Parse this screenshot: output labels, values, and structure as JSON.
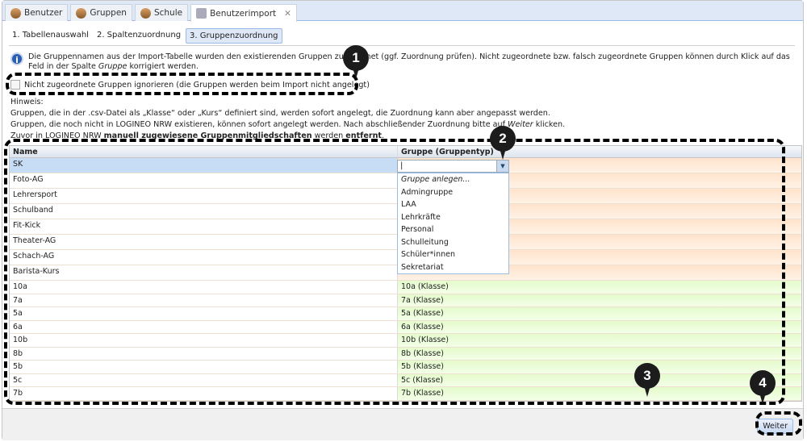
{
  "tabs": [
    {
      "label": "Benutzer",
      "icon": "user-icon"
    },
    {
      "label": "Gruppen",
      "icon": "group-icon"
    },
    {
      "label": "Schule",
      "icon": "school-icon"
    },
    {
      "label": "Benutzerimport",
      "icon": "import-icon",
      "active": true
    }
  ],
  "steps": [
    "1. Tabellenauswahl",
    "2. Spaltenzuordnung",
    "3. Gruppenzuordnung"
  ],
  "info": {
    "pre": "Die Gruppennamen aus der Import-Tabelle wurden den existierenden Gruppen zugeordnet (ggf. Zuordnung prüfen). Nicht zugeordnete bzw. falsch zugeordnete Gruppen können durch Klick auf das Feld in der Spalte ",
    "em": "Gruppe",
    "post": " korrigiert werden."
  },
  "checkbox": {
    "label": "Nicht zugeordnete Gruppen ignorieren (die Gruppen werden beim Import nicht angelegt)",
    "checked": false
  },
  "hint": {
    "title": "Hinweis:",
    "line1": "Gruppen, die in der .csv-Datei als „Klasse“ oder „Kurs“ definiert sind, werden sofort angelegt, die Zuordnung kann aber angepasst werden.",
    "line2_pre": "Gruppen, die noch nicht in LOGINEO NRW existieren, können sofort angelegt werden. Nach abschließender Zuordnung bitte auf ",
    "line2_em": "Weiter",
    "line2_post": " klicken.",
    "line3_pre": "Zuvor in LOGINEO NRW ",
    "line3_b1": "manuell zugewiesene Gruppenmitgliedschaften",
    "line3_mid": " werden ",
    "line3_b2": "entfernt",
    "line3_post": "."
  },
  "grid": {
    "headers": [
      "Name",
      "Gruppe (Gruppentyp)"
    ],
    "rows": [
      {
        "name": "SK",
        "group": "",
        "status": "unassigned"
      },
      {
        "name": "Foto-AG",
        "group": "",
        "status": "unassigned"
      },
      {
        "name": "Lehrersport",
        "group": "",
        "status": "unassigned"
      },
      {
        "name": "Schulband",
        "group": "",
        "status": "unassigned"
      },
      {
        "name": "Fit-Kick",
        "group": "",
        "status": "unassigned"
      },
      {
        "name": "Theater-AG",
        "group": "",
        "status": "unassigned"
      },
      {
        "name": "Schach-AG",
        "group": "",
        "status": "unassigned"
      },
      {
        "name": "Barista-Kurs",
        "group": "",
        "status": "unassigned"
      },
      {
        "name": "10a",
        "group": "10a (Klasse)",
        "status": "assigned"
      },
      {
        "name": "7a",
        "group": "7a (Klasse)",
        "status": "assigned"
      },
      {
        "name": "5a",
        "group": "5a (Klasse)",
        "status": "assigned"
      },
      {
        "name": "6a",
        "group": "6a (Klasse)",
        "status": "assigned"
      },
      {
        "name": "10b",
        "group": "10b (Klasse)",
        "status": "assigned"
      },
      {
        "name": "8b",
        "group": "8b (Klasse)",
        "status": "assigned"
      },
      {
        "name": "5b",
        "group": "5b (Klasse)",
        "status": "assigned"
      },
      {
        "name": "5c",
        "group": "5c (Klasse)",
        "status": "assigned"
      },
      {
        "name": "7b",
        "group": "7b (Klasse)",
        "status": "assigned"
      }
    ]
  },
  "dropdown": {
    "value": "",
    "options": [
      "Gruppe anlegen...",
      "Admingruppe",
      "LAA",
      "Lehrkräfte",
      "Personal",
      "Schulleitung",
      "Schüler*innen",
      "Sekretariat"
    ]
  },
  "footer": {
    "next_label": "Weiter"
  },
  "markers": [
    "1",
    "2",
    "3",
    "4"
  ]
}
